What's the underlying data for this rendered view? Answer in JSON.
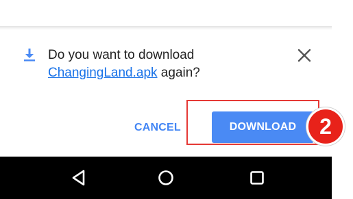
{
  "dialog": {
    "message_prefix": "Do you want to download",
    "filename": "ChangingLand.apk",
    "message_suffix": " again?",
    "cancel_label": "CANCEL",
    "download_label": "DOWNLOAD"
  },
  "annotation": {
    "step_number": "2",
    "color": "#e8221a"
  },
  "icons": {
    "download": "download-icon",
    "close": "close-icon",
    "back": "back-triangle-icon",
    "home": "home-circle-icon",
    "recents": "recents-square-icon"
  },
  "colors": {
    "accent": "#4285f4",
    "download_button": "#4a8af4",
    "nav_bar": "#000000"
  }
}
